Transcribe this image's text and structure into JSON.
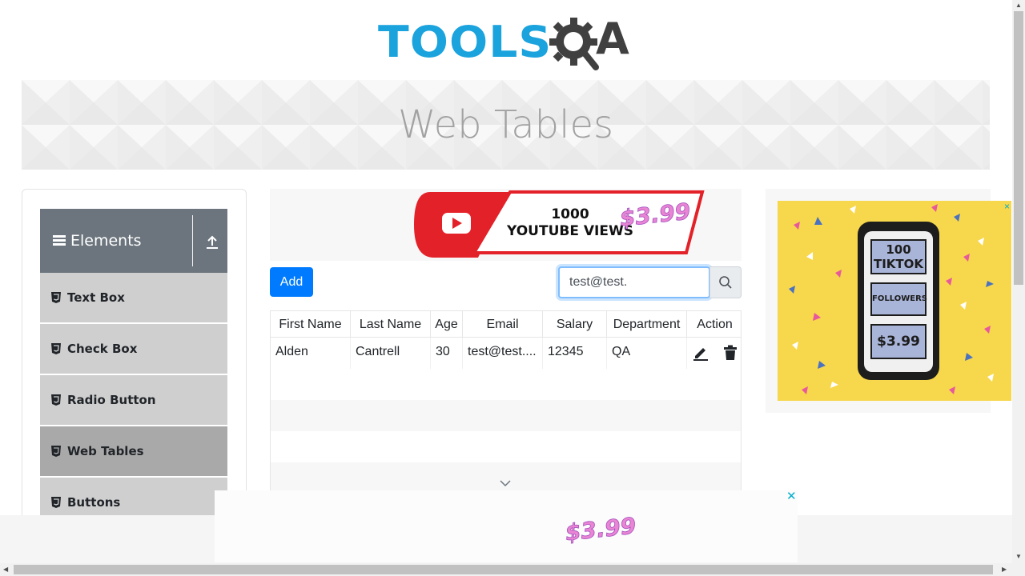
{
  "logo": {
    "text_tools": "TOOLS",
    "text_a": "A"
  },
  "banner": {
    "title": "Web Tables"
  },
  "sidebar": {
    "group": "Elements",
    "items": [
      {
        "label": "Text Box",
        "active": false
      },
      {
        "label": "Check Box",
        "active": false
      },
      {
        "label": "Radio Button",
        "active": false
      },
      {
        "label": "Web Tables",
        "active": true
      },
      {
        "label": "Buttons",
        "active": false
      }
    ]
  },
  "ads": {
    "top": {
      "line1": "1000",
      "line2": "YOUTUBE VIEWS",
      "price": "$3.99"
    },
    "right": {
      "line1": "100",
      "line2": "TIKTOK",
      "line3": "FOLLOWERS",
      "price": "$3.99",
      "close": "×"
    },
    "bottom": {
      "price": "$3.99",
      "close": "✕"
    }
  },
  "toolbar": {
    "add_label": "Add"
  },
  "search": {
    "value": "test@test."
  },
  "table": {
    "headers": [
      "First Name",
      "Last Name",
      "Age",
      "Email",
      "Salary",
      "Department",
      "Action"
    ],
    "rows": [
      {
        "first": "Alden",
        "last": "Cantrell",
        "age": "30",
        "email": "test@test....",
        "salary": "12345",
        "department": "QA"
      }
    ]
  },
  "colors": {
    "accent": "#007bff",
    "brand_blue": "#1ba3dd",
    "sidebar_header": "#6c757d",
    "menu_item": "#cfcfcf",
    "menu_active": "#a9a9a9"
  }
}
